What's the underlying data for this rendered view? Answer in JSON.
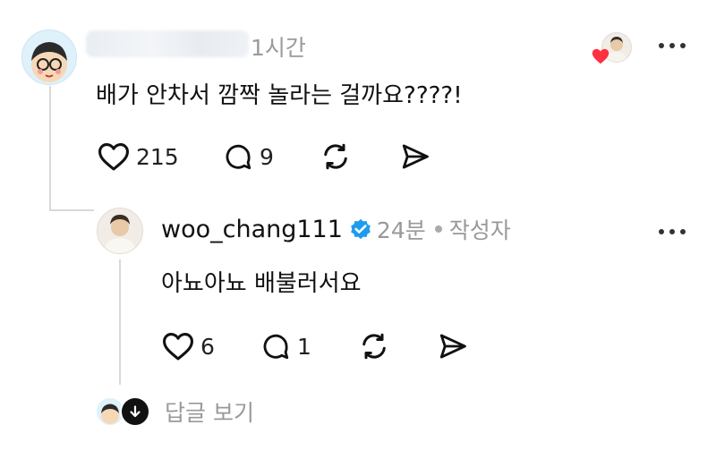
{
  "comment": {
    "time": "1시간",
    "text": "배가 안차서 깜짝 놀라는 걸까요????!",
    "actions": {
      "likes": "215",
      "replies": "9"
    }
  },
  "reply": {
    "username": "woo_chang111",
    "time": "24분",
    "author_tag": "작성자",
    "text": "아뇨아뇨 배불러서요",
    "actions": {
      "likes": "6",
      "replies": "1"
    }
  },
  "view_replies": {
    "label": "답글 보기"
  },
  "icons": {
    "like": "heart-icon",
    "comment": "comment-bubble-icon",
    "repost": "repost-icon",
    "share": "send-icon",
    "more": "more-horizontal-icon",
    "verified": "verified-badge-icon",
    "expand": "arrow-down-icon"
  },
  "colors": {
    "verified": "#1d9bf0",
    "heart_badge": "#ff3040",
    "muted_text": "#999999"
  }
}
